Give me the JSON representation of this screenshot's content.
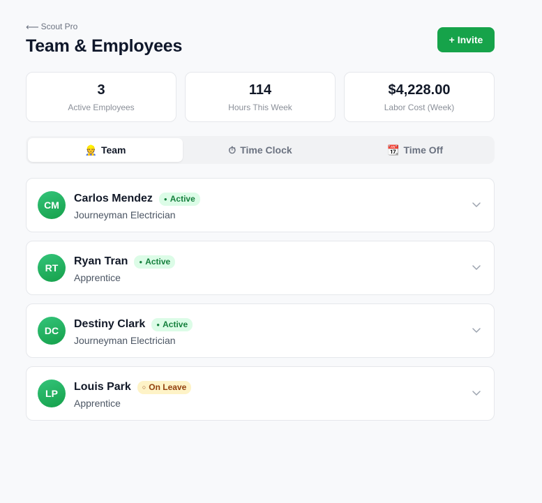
{
  "header": {
    "back_arrow": "⟵",
    "back_label": "Scout Pro",
    "title": "Team & Employees",
    "invite_label": "+ Invite"
  },
  "stats": [
    {
      "value": "3",
      "label": "Active Employees"
    },
    {
      "value": "114",
      "label": "Hours This Week"
    },
    {
      "value": "$4,228.00",
      "label": "Labor Cost (Week)"
    }
  ],
  "tabs": [
    {
      "icon": "👷",
      "icon_name": "worker-icon",
      "label": "Team",
      "active": true
    },
    {
      "icon": "⏱",
      "icon_name": "stopwatch-icon",
      "label": "Time Clock",
      "active": false
    },
    {
      "icon": "📆",
      "icon_name": "calendar-icon",
      "label": "Time Off",
      "active": false
    }
  ],
  "employees": [
    {
      "initials": "CM",
      "name": "Carlos Mendez",
      "status": "Active",
      "status_dot": "●",
      "role": "Journeyman Electrician"
    },
    {
      "initials": "RT",
      "name": "Ryan Tran",
      "status": "Active",
      "status_dot": "●",
      "role": "Apprentice"
    },
    {
      "initials": "DC",
      "name": "Destiny Clark",
      "status": "Active",
      "status_dot": "●",
      "role": "Journeyman Electrician"
    },
    {
      "initials": "LP",
      "name": "Louis Park",
      "status": "On Leave",
      "status_dot": "○",
      "role": "Apprentice"
    }
  ],
  "colors": {
    "accent": "#16a34a",
    "active_badge_bg": "#dcfce7",
    "active_badge_text": "#15803d",
    "leave_badge_bg": "#fef3c7",
    "leave_badge_text": "#92400e"
  }
}
